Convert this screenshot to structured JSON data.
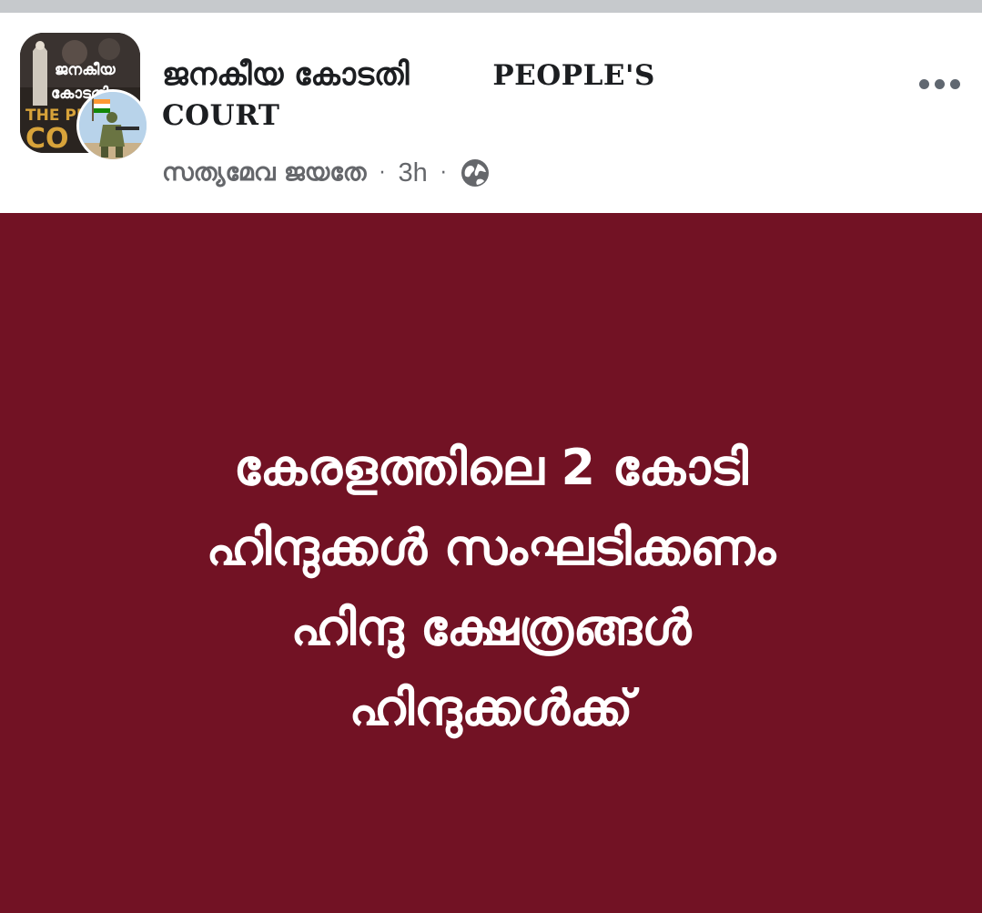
{
  "header": {
    "page_name_ml": "ജനകീയ കോടതി",
    "page_name_en_1": "PEOPLE'S",
    "page_name_en_2": "COURT",
    "author": "സത്യമേവ ജയതേ",
    "separator": "·",
    "time": "3h",
    "privacy_icon": "globe-icon",
    "more_icon": "more-dots-icon",
    "avatar_text_ml_1": "ജനകീയ",
    "avatar_text_ml_2": "കോടതി",
    "avatar_text_en_1": "THE PE",
    "avatar_text_en_2": "CO"
  },
  "post": {
    "background_color": "#721224",
    "text_color": "#ffffff",
    "lines": [
      "കേരളത്തിലെ 2 കോടി",
      "ഹിന്ദുക്കൾ സംഘടിക്കണം",
      "ഹിന്ദു ക്ഷേത്രങ്ങൾ",
      "ഹിന്ദുക്കൾക്ക്"
    ]
  }
}
